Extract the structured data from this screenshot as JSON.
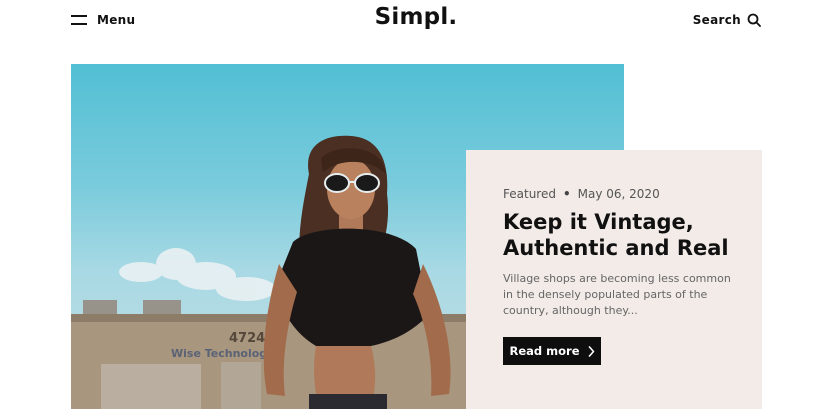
{
  "header": {
    "menu_label": "Menu",
    "logo": "Simpl.",
    "search_label": "Search"
  },
  "featured": {
    "category": "Featured",
    "separator": "•",
    "date": "May 06, 2020",
    "title": "Keep it Vintage, Authentic and Real",
    "excerpt": "Village shops are becoming less common in the densely populated parts of the country, although they...",
    "read_more_label": "Read more"
  },
  "hero_image": {
    "building_sign_number": "4724",
    "building_sign_text": "Wise Technologies"
  },
  "colors": {
    "card_background": "#f2ebe7",
    "button_background": "#0e0e0e",
    "sky": "#52bfd4"
  },
  "icons": {
    "menu": "hamburger-icon",
    "search": "search-icon",
    "read_more": "chevron-right-icon"
  }
}
